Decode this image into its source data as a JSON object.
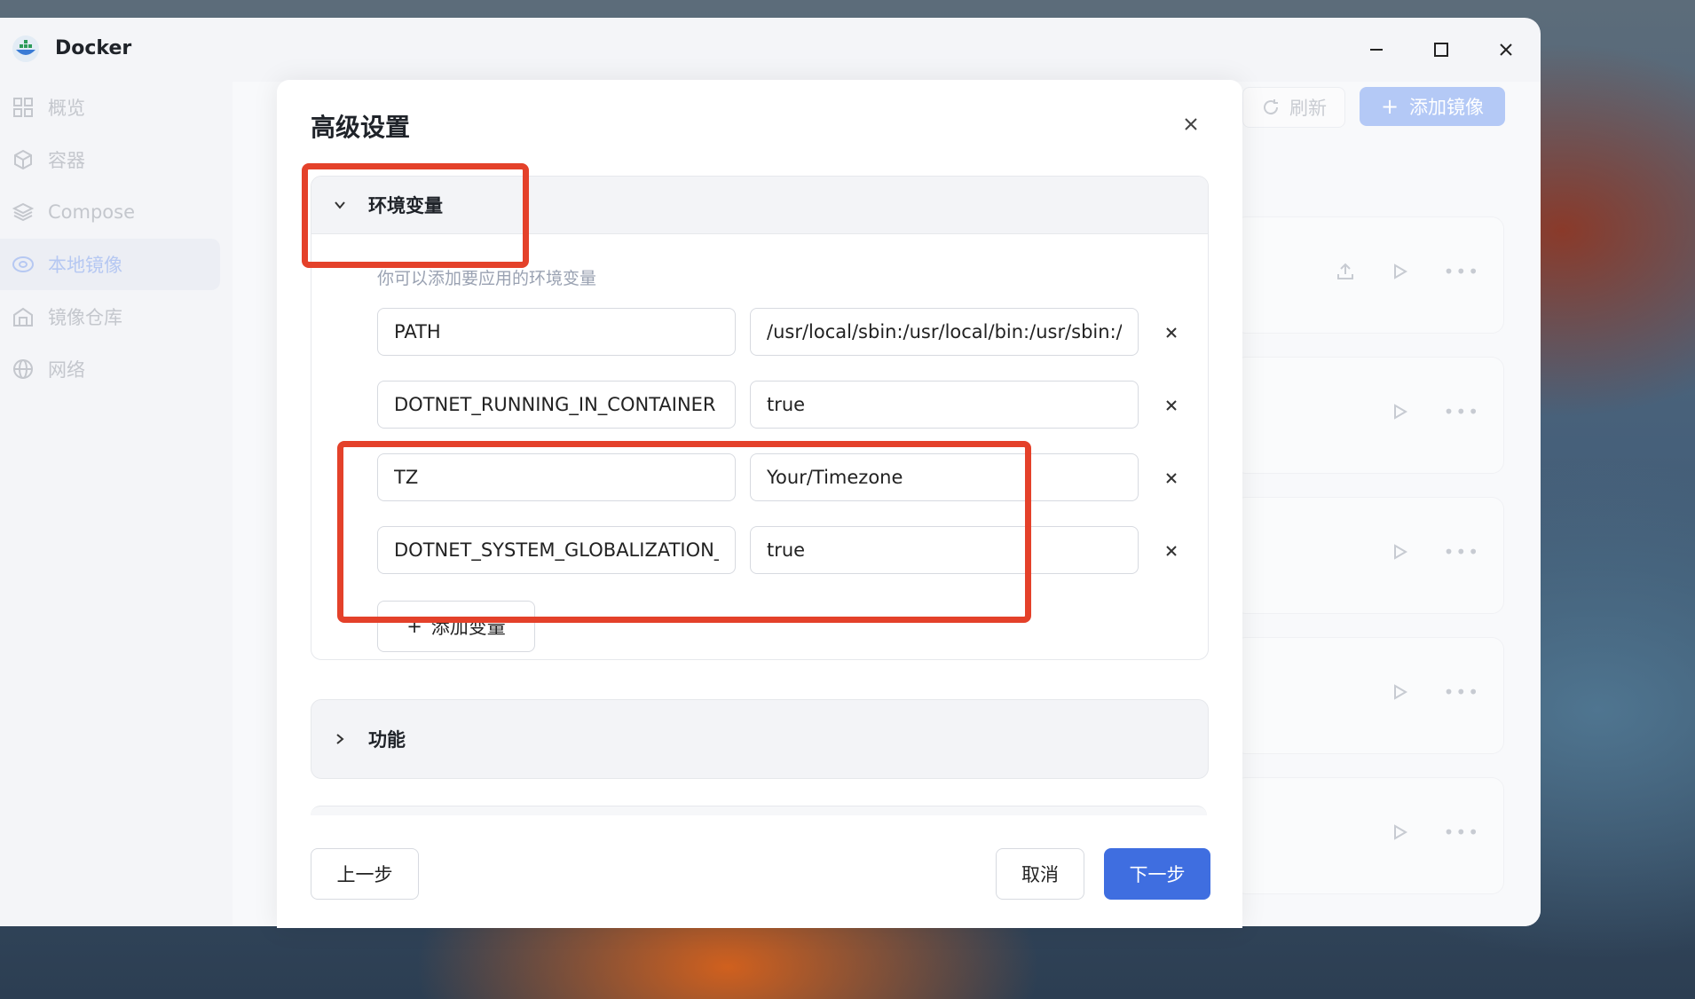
{
  "app": {
    "title": "Docker",
    "logo_icon": "docker-whale-icon"
  },
  "sidebar": {
    "items": [
      {
        "label": "概览",
        "icon": "grid-icon",
        "active": false
      },
      {
        "label": "容器",
        "icon": "cube-icon",
        "active": false
      },
      {
        "label": "Compose",
        "icon": "layers-icon",
        "active": false
      },
      {
        "label": "本地镜像",
        "icon": "disk-icon",
        "active": true
      },
      {
        "label": "镜像仓库",
        "icon": "warehouse-icon",
        "active": false
      },
      {
        "label": "网络",
        "icon": "globe-icon",
        "active": false
      }
    ]
  },
  "toolbar": {
    "refresh_label": "刷新",
    "add_image_label": "添加镜像"
  },
  "modal": {
    "title": "高级设置",
    "env_section": {
      "title": "环境变量",
      "description": "你可以添加要应用的环境变量",
      "variables": [
        {
          "key": "PATH",
          "value": "/usr/local/sbin:/usr/local/bin:/usr/sbin:/usr/bin:/sbin:/bin"
        },
        {
          "key": "DOTNET_RUNNING_IN_CONTAINER",
          "value": "true"
        },
        {
          "key": "TZ",
          "value": "Your/Timezone"
        },
        {
          "key": "DOTNET_SYSTEM_GLOBALIZATION_INVARIANT",
          "value": "true"
        }
      ],
      "add_label": "添加变量"
    },
    "func_section": {
      "title": "功能"
    },
    "footer": {
      "prev_label": "上一步",
      "cancel_label": "取消",
      "next_label": "下一步"
    }
  },
  "colors": {
    "accent": "#3f6ee0",
    "highlight": "#e4412a"
  }
}
